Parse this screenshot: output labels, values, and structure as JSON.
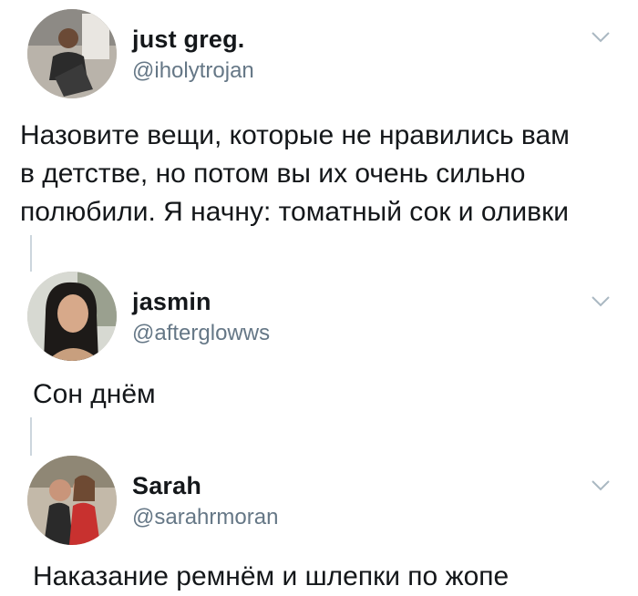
{
  "tweets": [
    {
      "name": "just greg.",
      "handle": "@iholytrojan",
      "text": "Назовите вещи, которые не нравились вам\nв детстве, но потом вы их очень сильно\nполюбили. Я начну: томатный сок и оливки"
    },
    {
      "name": "jasmin",
      "handle": "@afterglowws",
      "text": "Сон днём"
    },
    {
      "name": "Sarah",
      "handle": "@sarahrmoran",
      "text": "Наказание ремнём и шлепки по жопе"
    }
  ]
}
